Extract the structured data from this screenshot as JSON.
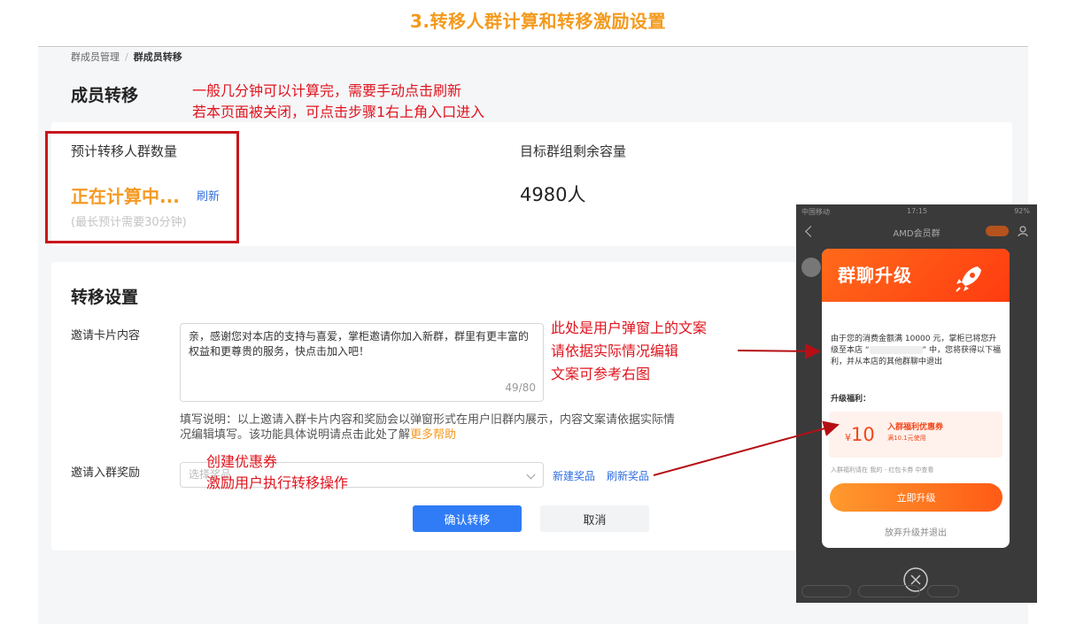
{
  "heading": "3.转移人群计算和转移激励设置",
  "breadcrumb": {
    "parent": "群成员管理",
    "separator": "/",
    "current": "群成员转移"
  },
  "page_title": "成员转移",
  "annotations": {
    "calc_line1": "一般几分钟可以计算完，需要手动点击刷新",
    "calc_line2": "若本页面被关闭，可点击步骤1右上角入口进入",
    "popup_line1": "此处是用户弹窗上的文案",
    "popup_line2": "请依据实际情况编辑",
    "popup_line3": "文案可参考右图",
    "coupon_line1": "创建优惠券",
    "coupon_line2": "激励用户执行转移操作"
  },
  "stats": {
    "predict_label": "预计转移人群数量",
    "calc_status": "正在计算中...",
    "refresh": "刷新",
    "calc_hint": "(最长预计需要30分钟)",
    "target_label": "目标群组剩余容量",
    "target_value": "4980人"
  },
  "settings": {
    "title": "转移设置",
    "invite_label": "邀请卡片内容",
    "invite_text": "亲，感谢您对本店的支持与喜爱，掌柜邀请你加入新群，群里有更丰富的权益和更尊贵的服务，快点击加入吧！",
    "char_count": "49/80",
    "note_text": "填写说明：以上邀请入群卡片内容和奖励会以弹窗形式在用户旧群内展示，内容文案请依据实际情况编辑填写。该功能具体说明请点击此处了解",
    "more_help": "更多帮助",
    "reward_label": "邀请入群奖励",
    "reward_placeholder": "选择奖品",
    "new_reward": "新建奖品",
    "refresh_reward": "刷新奖品",
    "confirm": "确认转移",
    "cancel": "取消"
  },
  "phone": {
    "carrier": "中国移动",
    "time": "17:15",
    "battery": "92%",
    "group_name": "AMD会员群",
    "modal_title": "群聊升级",
    "body_prefix": "由于您的消费金额满 10000 元，掌柜已将您升级至本店 “",
    "body_suffix": "” 中，您将获得以下福利，并从本店的其他群聊中退出",
    "benefit_label": "升级福利：",
    "coupon_amount": "10",
    "coupon_currency": "¥",
    "coupon_title": "入群福利优惠券",
    "coupon_desc": "满10.1元使用",
    "coupon_notes": "入群福利请在 我的 - 红包卡券 中查看",
    "upgrade_button": "立即升级",
    "giveup_link": "放弃升级并退出"
  },
  "colors": {
    "heading": "#f39a1e",
    "annotation": "#e0141e",
    "link": "#2f6ee0",
    "primary": "#2f7cf6",
    "calc": "#f59a23"
  }
}
